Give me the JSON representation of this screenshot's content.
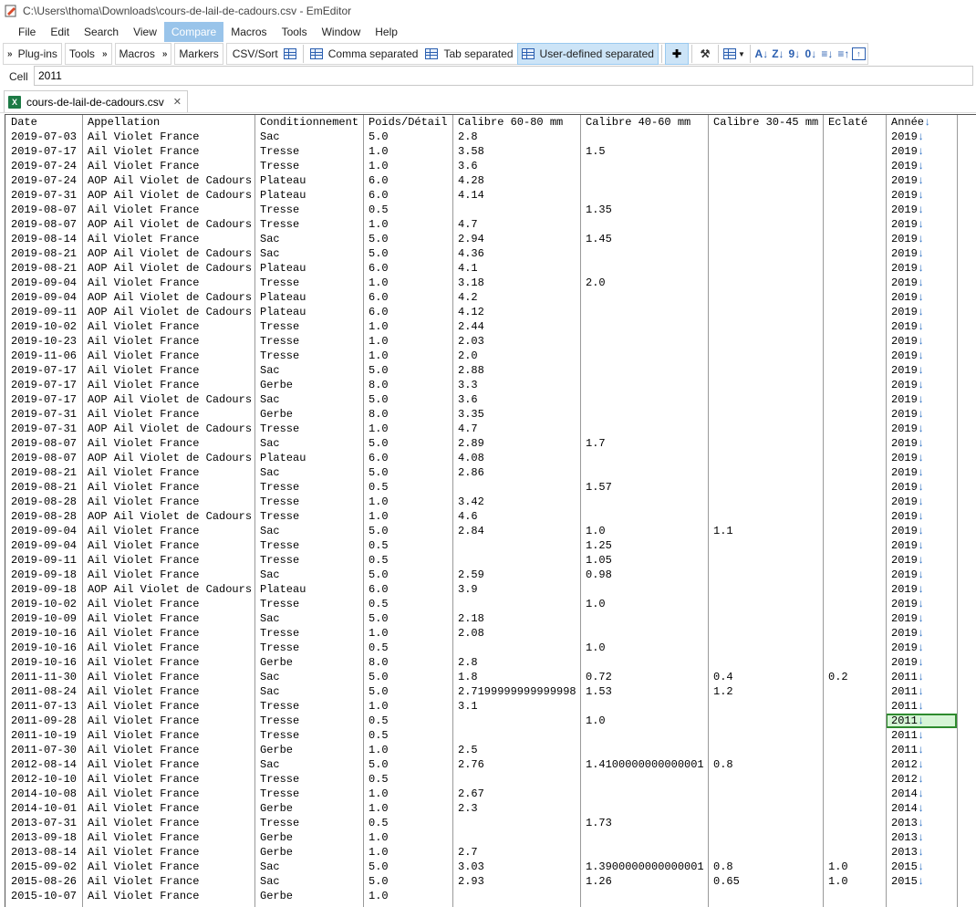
{
  "window": {
    "title": "C:\\Users\\thoma\\Downloads\\cours-de-lail-de-cadours.csv - EmEditor"
  },
  "menu": [
    "File",
    "Edit",
    "Search",
    "View",
    "Compare",
    "Macros",
    "Tools",
    "Window",
    "Help"
  ],
  "menu_active": "Compare",
  "toolbar": {
    "plugins": "Plug-ins",
    "tools": "Tools",
    "macros": "Macros",
    "markers": "Markers",
    "csv_sort": "CSV/Sort",
    "comma": "Comma separated",
    "tab": "Tab separated",
    "user_defined": "User-defined separated"
  },
  "cellbar": {
    "label": "Cell",
    "value": "2011"
  },
  "tab": {
    "filename": "cours-de-lail-de-cadours.csv"
  },
  "grid": {
    "headers": [
      "Date",
      "Appellation",
      "Conditionnement",
      "Poids/Détail",
      "Calibre 60-80 mm",
      "Calibre 40-60 mm",
      "Calibre 30-45 mm",
      "Eclaté",
      "Année"
    ],
    "end_marker": "↓",
    "rows": [
      [
        "2019-07-03",
        "Ail Violet France",
        "Sac",
        "5.0",
        "2.8",
        "",
        "",
        "",
        "2019"
      ],
      [
        "2019-07-17",
        "Ail Violet France",
        "Tresse",
        "1.0",
        "3.58",
        "1.5",
        "",
        "",
        "2019"
      ],
      [
        "2019-07-24",
        "Ail Violet France",
        "Tresse",
        "1.0",
        "3.6",
        "",
        "",
        "",
        "2019"
      ],
      [
        "2019-07-24",
        "AOP Ail Violet de Cadours",
        "Plateau",
        "6.0",
        "4.28",
        "",
        "",
        "",
        "2019"
      ],
      [
        "2019-07-31",
        "AOP Ail Violet de Cadours",
        "Plateau",
        "6.0",
        "4.14",
        "",
        "",
        "",
        "2019"
      ],
      [
        "2019-08-07",
        "Ail Violet France",
        "Tresse",
        "0.5",
        "",
        "1.35",
        "",
        "",
        "2019"
      ],
      [
        "2019-08-07",
        "AOP Ail Violet de Cadours",
        "Tresse",
        "1.0",
        "4.7",
        "",
        "",
        "",
        "2019"
      ],
      [
        "2019-08-14",
        "Ail Violet France",
        "Sac",
        "5.0",
        "2.94",
        "1.45",
        "",
        "",
        "2019"
      ],
      [
        "2019-08-21",
        "AOP Ail Violet de Cadours",
        "Sac",
        "5.0",
        "4.36",
        "",
        "",
        "",
        "2019"
      ],
      [
        "2019-08-21",
        "AOP Ail Violet de Cadours",
        "Plateau",
        "6.0",
        "4.1",
        "",
        "",
        "",
        "2019"
      ],
      [
        "2019-09-04",
        "Ail Violet France",
        "Tresse",
        "1.0",
        "3.18",
        "2.0",
        "",
        "",
        "2019"
      ],
      [
        "2019-09-04",
        "AOP Ail Violet de Cadours",
        "Plateau",
        "6.0",
        "4.2",
        "",
        "",
        "",
        "2019"
      ],
      [
        "2019-09-11",
        "AOP Ail Violet de Cadours",
        "Plateau",
        "6.0",
        "4.12",
        "",
        "",
        "",
        "2019"
      ],
      [
        "2019-10-02",
        "Ail Violet France",
        "Tresse",
        "1.0",
        "2.44",
        "",
        "",
        "",
        "2019"
      ],
      [
        "2019-10-23",
        "Ail Violet France",
        "Tresse",
        "1.0",
        "2.03",
        "",
        "",
        "",
        "2019"
      ],
      [
        "2019-11-06",
        "Ail Violet France",
        "Tresse",
        "1.0",
        "2.0",
        "",
        "",
        "",
        "2019"
      ],
      [
        "2019-07-17",
        "Ail Violet France",
        "Sac",
        "5.0",
        "2.88",
        "",
        "",
        "",
        "2019"
      ],
      [
        "2019-07-17",
        "Ail Violet France",
        "Gerbe",
        "8.0",
        "3.3",
        "",
        "",
        "",
        "2019"
      ],
      [
        "2019-07-17",
        "AOP Ail Violet de Cadours",
        "Sac",
        "5.0",
        "3.6",
        "",
        "",
        "",
        "2019"
      ],
      [
        "2019-07-31",
        "Ail Violet France",
        "Gerbe",
        "8.0",
        "3.35",
        "",
        "",
        "",
        "2019"
      ],
      [
        "2019-07-31",
        "AOP Ail Violet de Cadours",
        "Tresse",
        "1.0",
        "4.7",
        "",
        "",
        "",
        "2019"
      ],
      [
        "2019-08-07",
        "Ail Violet France",
        "Sac",
        "5.0",
        "2.89",
        "1.7",
        "",
        "",
        "2019"
      ],
      [
        "2019-08-07",
        "AOP Ail Violet de Cadours",
        "Plateau",
        "6.0",
        "4.08",
        "",
        "",
        "",
        "2019"
      ],
      [
        "2019-08-21",
        "Ail Violet France",
        "Sac",
        "5.0",
        "2.86",
        "",
        "",
        "",
        "2019"
      ],
      [
        "2019-08-21",
        "Ail Violet France",
        "Tresse",
        "0.5",
        "",
        "1.57",
        "",
        "",
        "2019"
      ],
      [
        "2019-08-28",
        "Ail Violet France",
        "Tresse",
        "1.0",
        "3.42",
        "",
        "",
        "",
        "2019"
      ],
      [
        "2019-08-28",
        "AOP Ail Violet de Cadours",
        "Tresse",
        "1.0",
        "4.6",
        "",
        "",
        "",
        "2019"
      ],
      [
        "2019-09-04",
        "Ail Violet France",
        "Sac",
        "5.0",
        "2.84",
        "1.0",
        "1.1",
        "",
        "2019"
      ],
      [
        "2019-09-04",
        "Ail Violet France",
        "Tresse",
        "0.5",
        "",
        "1.25",
        "",
        "",
        "2019"
      ],
      [
        "2019-09-11",
        "Ail Violet France",
        "Tresse",
        "0.5",
        "",
        "1.05",
        "",
        "",
        "2019"
      ],
      [
        "2019-09-18",
        "Ail Violet France",
        "Sac",
        "5.0",
        "2.59",
        "0.98",
        "",
        "",
        "2019"
      ],
      [
        "2019-09-18",
        "AOP Ail Violet de Cadours",
        "Plateau",
        "6.0",
        "3.9",
        "",
        "",
        "",
        "2019"
      ],
      [
        "2019-10-02",
        "Ail Violet France",
        "Tresse",
        "0.5",
        "",
        "1.0",
        "",
        "",
        "2019"
      ],
      [
        "2019-10-09",
        "Ail Violet France",
        "Sac",
        "5.0",
        "2.18",
        "",
        "",
        "",
        "2019"
      ],
      [
        "2019-10-16",
        "Ail Violet France",
        "Tresse",
        "1.0",
        "2.08",
        "",
        "",
        "",
        "2019"
      ],
      [
        "2019-10-16",
        "Ail Violet France",
        "Tresse",
        "0.5",
        "",
        "1.0",
        "",
        "",
        "2019"
      ],
      [
        "2019-10-16",
        "Ail Violet France",
        "Gerbe",
        "8.0",
        "2.8",
        "",
        "",
        "",
        "2019"
      ],
      [
        "2011-11-30",
        "Ail Violet France",
        "Sac",
        "5.0",
        "1.8",
        "0.72",
        "0.4",
        "0.2",
        "2011"
      ],
      [
        "2011-08-24",
        "Ail Violet France",
        "Sac",
        "5.0",
        "2.7199999999999998",
        "1.53",
        "1.2",
        "",
        "2011"
      ],
      [
        "2011-07-13",
        "Ail Violet France",
        "Tresse",
        "1.0",
        "3.1",
        "",
        "",
        "",
        "2011"
      ],
      [
        "2011-09-28",
        "Ail Violet France",
        "Tresse",
        "0.5",
        "",
        "1.0",
        "",
        "",
        "2011"
      ],
      [
        "2011-10-19",
        "Ail Violet France",
        "Tresse",
        "0.5",
        "",
        "",
        "",
        "",
        "2011"
      ],
      [
        "2011-07-30",
        "Ail Violet France",
        "Gerbe",
        "1.0",
        "2.5",
        "",
        "",
        "",
        "2011"
      ],
      [
        "2012-08-14",
        "Ail Violet France",
        "Sac",
        "5.0",
        "2.76",
        "1.4100000000000001",
        "0.8",
        "",
        "2012"
      ],
      [
        "2012-10-10",
        "Ail Violet France",
        "Tresse",
        "0.5",
        "",
        "",
        "",
        "",
        "2012"
      ],
      [
        "2014-10-08",
        "Ail Violet France",
        "Tresse",
        "1.0",
        "2.67",
        "",
        "",
        "",
        "2014"
      ],
      [
        "2014-10-01",
        "Ail Violet France",
        "Gerbe",
        "1.0",
        "2.3",
        "",
        "",
        "",
        "2014"
      ],
      [
        "2013-07-31",
        "Ail Violet France",
        "Tresse",
        "0.5",
        "",
        "1.73",
        "",
        "",
        "2013"
      ],
      [
        "2013-09-18",
        "Ail Violet France",
        "Gerbe",
        "1.0",
        "",
        "",
        "",
        "",
        "2013"
      ],
      [
        "2013-08-14",
        "Ail Violet France",
        "Gerbe",
        "1.0",
        "2.7",
        "",
        "",
        "",
        "2013"
      ],
      [
        "2015-09-02",
        "Ail Violet France",
        "Sac",
        "5.0",
        "3.03",
        "1.3900000000000001",
        "0.8",
        "1.0",
        "2015"
      ],
      [
        "2015-08-26",
        "Ail Violet France",
        "Sac",
        "5.0",
        "2.93",
        "1.26",
        "0.65",
        "1.0",
        "2015"
      ],
      [
        "2015-10-07",
        "Ail Violet France",
        "Gerbe",
        "1.0",
        "",
        "",
        "",
        "",
        ""
      ]
    ],
    "selected_row": 40,
    "selected_col": 8
  },
  "colors": {
    "menu_active_bg": "#99c4ea",
    "selection_border": "#2e8b2e",
    "selection_bg": "#d6f5d6",
    "eol_arrow": "#2a6fc4"
  }
}
